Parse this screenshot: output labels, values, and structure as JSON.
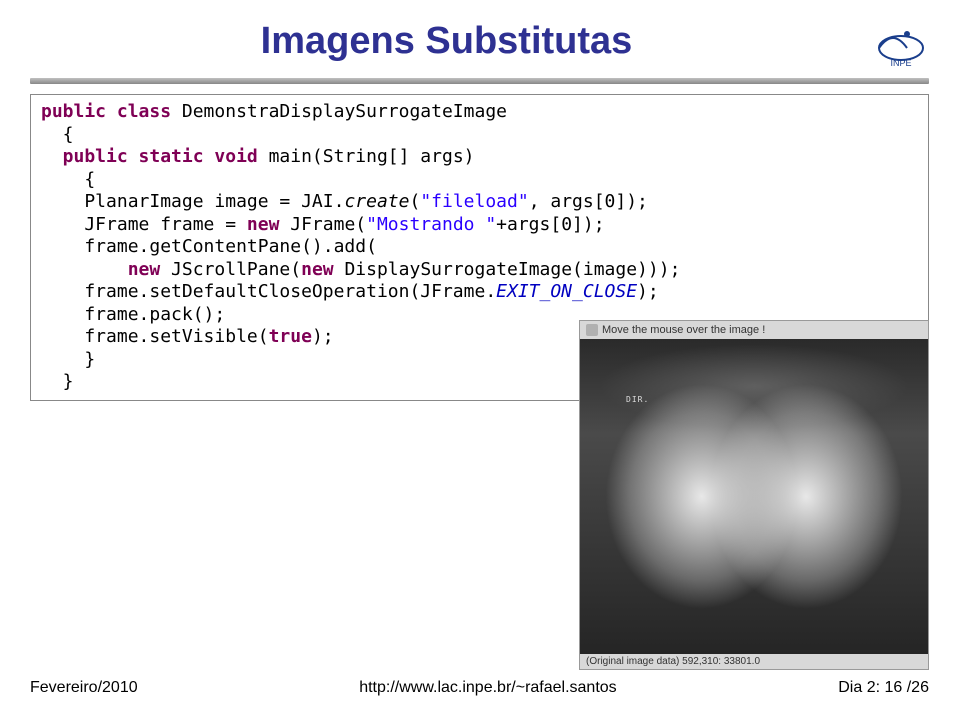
{
  "title": "Imagens Substitutas",
  "logo_label": "INPE",
  "code": {
    "l1a": "public class",
    "l1b": " DemonstraDisplaySurrogateImage",
    "l2": "  {",
    "l3a": "  public static void",
    "l3b": " main(String[] args)",
    "l4": "    {",
    "l5a": "    PlanarImage image = JAI.",
    "l5b": "create",
    "l5c": "(",
    "l5d": "\"fileload\"",
    "l5e": ", args[0]);",
    "l6a": "    JFrame frame = ",
    "l6b": "new",
    "l6c": " JFrame(",
    "l6d": "\"Mostrando \"",
    "l6e": "+args[0]);",
    "l7": "    frame.getContentPane().add(",
    "l8a": "        new",
    "l8b": " JScrollPane(",
    "l8c": "new",
    "l8d": " DisplaySurrogateImage(image)));",
    "l9a": "    frame.setDefaultCloseOperation(JFrame.",
    "l9b": "EXIT_ON_CLOSE",
    "l9c": ");",
    "l10": "    frame.pack();",
    "l11a": "    frame.setVisible(",
    "l11b": "true",
    "l11c": ");",
    "l12": "    }",
    "l13": "  }"
  },
  "preview": {
    "title": "Move the mouse over the image !",
    "dir": "DIR.",
    "status": "(Original image data) 592,310: 33801.0"
  },
  "footer": {
    "left": "Fevereiro/2010",
    "center": "http://www.lac.inpe.br/~rafael.santos",
    "right_label": "Dia 2:",
    "right_page": " 16 /26"
  }
}
